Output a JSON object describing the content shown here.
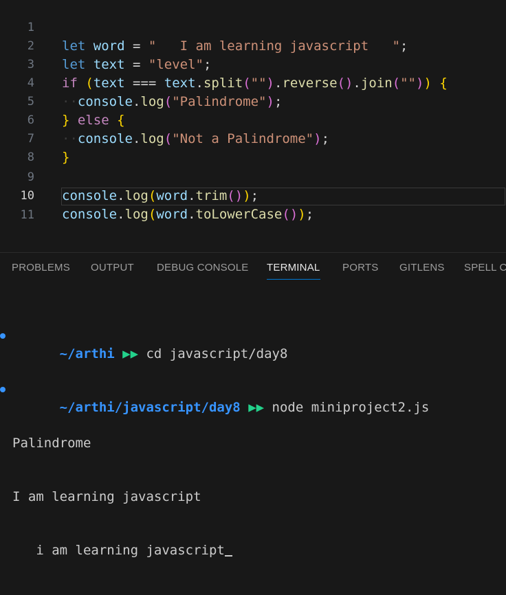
{
  "editor": {
    "line_numbers": [
      "1",
      "2",
      "3",
      "4",
      "5",
      "6",
      "7",
      "8",
      "9",
      "10",
      "11"
    ],
    "tokens": {
      "let": "let",
      "word": "word",
      "text": "text",
      "eq": " = ",
      "str1": "\"   I am learning javascript   \"",
      "semi": ";",
      "str2": "\"level\"",
      "if": "if",
      "open_paren": "(",
      "triple_eq": " === ",
      "dot_split": ".",
      "split": "split",
      "empty_str": "\"\"",
      "reverse": "reverse",
      "join": "join",
      "close_paren": ")",
      "brace_open": "{",
      "brace_close": "}",
      "console": "console",
      "log": "log",
      "str_pal": "\"Palindrome\"",
      "str_notpal": "\"Not a Palindrome\"",
      "else": "else",
      "trim": "trim",
      "toLowerCase": "toLowerCase"
    }
  },
  "panel": {
    "tabs": [
      "PROBLEMS",
      "OUTPUT",
      "DEBUG CONSOLE",
      "TERMINAL",
      "PORTS",
      "GITLENS",
      "SPELL CH"
    ],
    "active_tab": "TERMINAL"
  },
  "terminal": {
    "line1_path": "~/arthi",
    "line1_arrow": " ▶▶ ",
    "line1_cmd": "cd javascript/day8",
    "line2_path": "~/arthi/javascript/day8",
    "line2_arrow": " ▶▶ ",
    "line2_cmd": "node miniproject2.js",
    "out1": "Palindrome",
    "out2": "I am learning javascript",
    "out3": "   i am learning javascript"
  },
  "colors": {
    "background": "#181818",
    "keyword": "#569cd6",
    "control_keyword": "#c586c0",
    "variable": "#9cdcfe",
    "function": "#dcdcaa",
    "string": "#ce9178",
    "terminal_path": "#3794ff",
    "terminal_arrow": "#23d18b",
    "active_tab_underline": "#0078d4"
  }
}
